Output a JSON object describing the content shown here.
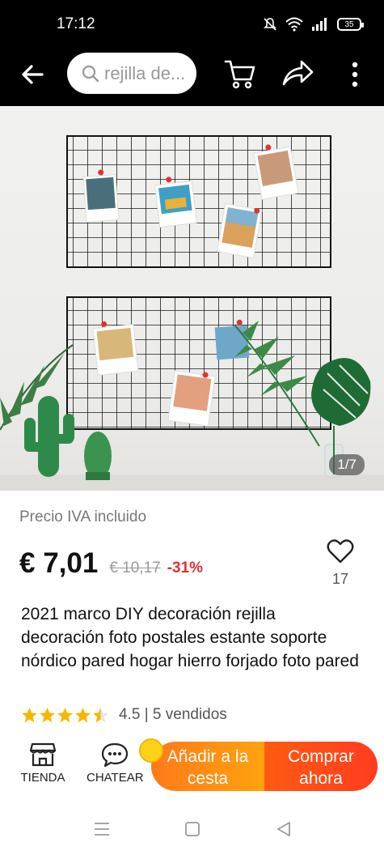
{
  "status_bar": {
    "time": "17:12",
    "battery": "35"
  },
  "header": {
    "search_placeholder": "rejilla de..."
  },
  "gallery": {
    "counter": "1/7"
  },
  "product": {
    "vat_label": "Precio IVA incluido",
    "price": "€ 7,01",
    "original_price": "€ 10,17",
    "discount": "-31%",
    "favorites_count": "17",
    "title": "2021 marco DIY decoración rejilla decoración foto postales estante soporte nórdico pared hogar hierro forjado foto pared",
    "rating": 4.5,
    "rating_text": "4.5 | 5 vendidos"
  },
  "action_bar": {
    "store_label": "TIENDA",
    "chat_label": "CHATEAR",
    "add_to_cart_label": "Añadir a la cesta",
    "buy_now_label": "Comprar ahora"
  },
  "colors": {
    "accent_orange": "#ff7a1a",
    "buy_red": "#ff3d1f",
    "discount_red": "#e62e2e",
    "star_yellow": "#f5b800"
  }
}
